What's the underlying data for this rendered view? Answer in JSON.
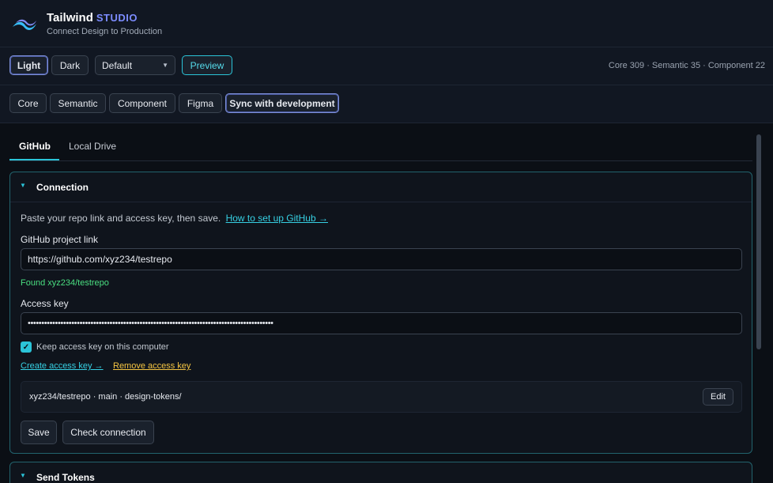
{
  "header": {
    "app_name": "Tailwind",
    "app_badge": "STUDIO",
    "tagline": "Connect Design to Production",
    "logo_icon": "tailwind-wave-icon"
  },
  "toolbar": {
    "light_label": "Light",
    "dark_label": "Dark",
    "theme_select_value": "Default",
    "preview_label": "Preview",
    "counts": "Core 309 · Semantic 35 · Component 22"
  },
  "tabs": [
    {
      "label": "Core"
    },
    {
      "label": "Semantic"
    },
    {
      "label": "Component"
    },
    {
      "label": "Figma"
    },
    {
      "label": "Sync with development"
    }
  ],
  "subtabs": [
    {
      "label": "GitHub"
    },
    {
      "label": "Local Drive"
    }
  ],
  "connection": {
    "title": "Connection",
    "info": "Paste your repo link and access key, then save.",
    "setup_link": "How to set up GitHub →",
    "project_label": "GitHub project link",
    "project_value": "https://github.com/xyz234/testrepo",
    "found_text": "Found xyz234/testrepo",
    "key_label": "Access key",
    "key_value": "••••••••••••••••••••••••••••••••••••••••••••••••••••••••••••••••••••••••••••••••••••••••••",
    "keep_label": "Keep access key on this computer",
    "keep_checked": true,
    "create_link": "Create access key →",
    "remove_link": "Remove access key",
    "repo_summary": "xyz234/testrepo · main · design-tokens/",
    "edit_label": "Edit",
    "save_label": "Save",
    "check_label": "Check connection"
  },
  "send_tokens": {
    "title": "Send Tokens"
  },
  "colors": {
    "accent": "#2bc4d8",
    "found": "#4ade80",
    "warning_link": "#f5c542",
    "background": "#0d1117"
  }
}
